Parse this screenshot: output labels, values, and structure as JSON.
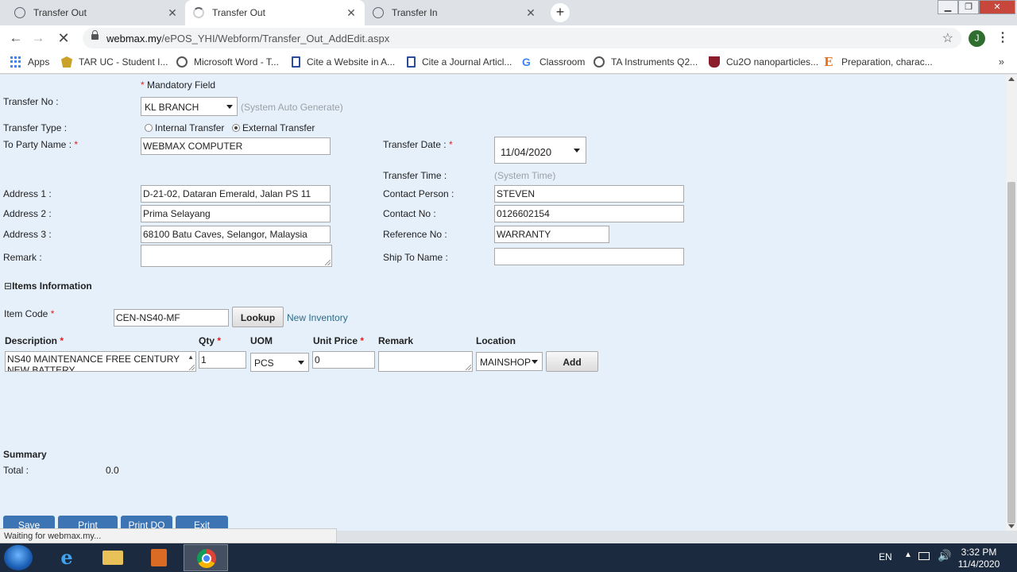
{
  "browser": {
    "tabs": [
      {
        "title": "Transfer Out",
        "state": "loaded"
      },
      {
        "title": "Transfer Out",
        "state": "loading"
      },
      {
        "title": "Transfer In",
        "state": "loaded"
      }
    ],
    "url_host": "webmax.my",
    "url_path": "/ePOS_YHI/Webform/Transfer_Out_AddEdit.aspx",
    "profile_initial": "J",
    "bookmarks": [
      {
        "label": "Apps",
        "icon": "apps-grid-icon"
      },
      {
        "label": "TAR UC - Student I...",
        "icon": "tar-uc-icon"
      },
      {
        "label": "Microsoft Word - T...",
        "icon": "globe-icon"
      },
      {
        "label": "Cite a Website in A...",
        "icon": "citation-icon"
      },
      {
        "label": "Cite a Journal Articl...",
        "icon": "citation-icon"
      },
      {
        "label": "Classroom",
        "icon": "google-icon"
      },
      {
        "label": "TA Instruments Q2...",
        "icon": "globe-icon"
      },
      {
        "label": "Cu2O nanoparticles...",
        "icon": "shield-icon"
      },
      {
        "label": "Preparation, charac...",
        "icon": "elsevier-icon"
      }
    ],
    "status_text": "Waiting for webmax.my..."
  },
  "form": {
    "mandatory_note": "Mandatory Field",
    "transfer_no_label": "Transfer No :",
    "transfer_no_value": "KL BRANCH",
    "transfer_no_hint": "(System Auto Generate)",
    "transfer_type_label": "Transfer Type :",
    "transfer_type_internal": "Internal Transfer",
    "transfer_type_external": "External Transfer",
    "transfer_type_selected": "External Transfer",
    "to_party_label": "To Party Name :",
    "to_party_value": "WEBMAX COMPUTER",
    "transfer_date_label": "Transfer Date  :",
    "transfer_date_value": "11/04/2020",
    "transfer_time_label": "Transfer Time :",
    "transfer_time_hint": "(System Time)",
    "address1_label": "Address 1 :",
    "address1_value": "D-21-02, Dataran Emerald, Jalan PS 11",
    "address2_label": "Address 2 :",
    "address2_value": "Prima Selayang",
    "address3_label": "Address 3 :",
    "address3_value": "68100 Batu Caves, Selangor, Malaysia",
    "remark_label": "Remark :",
    "remark_value": "",
    "contact_person_label": "Contact Person :",
    "contact_person_value": "STEVEN",
    "contact_no_label": "Contact No :",
    "contact_no_value": "0126602154",
    "reference_no_label": "Reference No :",
    "reference_no_value": "WARRANTY",
    "ship_to_label": "Ship To Name :",
    "ship_to_value": ""
  },
  "items": {
    "section_toggle": "⊟",
    "section_title": "Items Information",
    "item_code_label": "Item Code",
    "item_code_value": "CEN-NS40-MF",
    "lookup_button": "Lookup",
    "new_inventory_link": "New Inventory",
    "columns": {
      "description": "Description",
      "qty": "Qty",
      "uom": "UOM",
      "unit_price": "Unit Price",
      "remark": "Remark",
      "location": "Location"
    },
    "row": {
      "description": "NS40 MAINTENANCE FREE CENTURY NEW BATTERY",
      "qty": "1",
      "uom": "PCS",
      "unit_price": "0",
      "remark": "",
      "location": "MAINSHOP"
    },
    "add_button": "Add"
  },
  "summary": {
    "title": "Summary",
    "total_label": "Total :",
    "total_value": "0.0"
  },
  "actions": {
    "save": "Save",
    "print": "Print",
    "print_do": "Print DO",
    "exit": "Exit"
  },
  "taskbar": {
    "language": "EN",
    "time": "3:32 PM",
    "date": "11/4/2020"
  },
  "colors": {
    "page_background": "#e6f0fb",
    "action_button": "#3c74b4",
    "required_star": "#dd2222",
    "link": "#2e6b87"
  }
}
